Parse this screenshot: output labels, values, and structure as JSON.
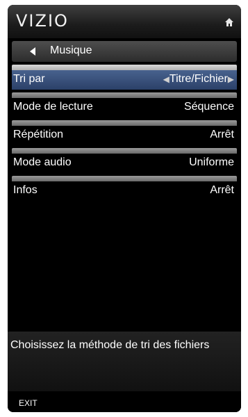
{
  "header": {
    "logo_text": "VIZIO",
    "home_icon": "home-icon"
  },
  "breadcrumb": {
    "back_icon": "back-arrow-icon",
    "label": "Musique"
  },
  "menu": {
    "items": [
      {
        "label": "Tri par",
        "value": "Titre/Fichier",
        "selected": true
      },
      {
        "label": "Mode de lecture",
        "value": "Séquence",
        "selected": false
      },
      {
        "label": "Répétition",
        "value": "Arrêt",
        "selected": false
      },
      {
        "label": "Mode audio",
        "value": "Uniforme",
        "selected": false
      },
      {
        "label": "Infos",
        "value": "Arrêt",
        "selected": false
      }
    ]
  },
  "help": {
    "text": "Choisissez la méthode de tri des fichiers"
  },
  "footer": {
    "exit_label": "EXIT"
  },
  "colors": {
    "background": "#000000",
    "selected_row": "#3a5280",
    "text": "#ffffff"
  }
}
